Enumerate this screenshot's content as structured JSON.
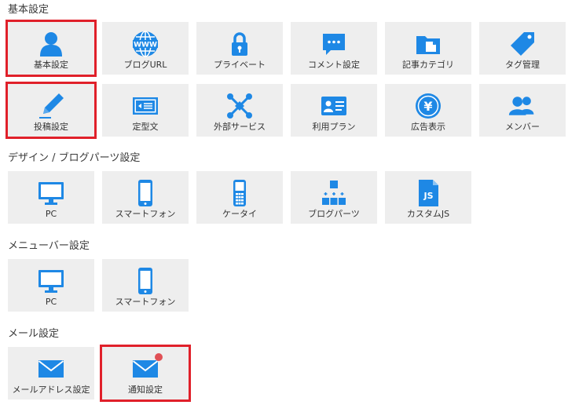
{
  "accent": "#1e88e5",
  "highlight_color": "#e0202a",
  "sections": [
    {
      "title": "基本設定",
      "tiles": [
        {
          "label": "基本設定",
          "icon": "user-icon",
          "highlighted": true
        },
        {
          "label": "ブログURL",
          "icon": "www-globe-icon"
        },
        {
          "label": "プライベート",
          "icon": "lock-icon"
        },
        {
          "label": "コメント設定",
          "icon": "comment-bubble-icon"
        },
        {
          "label": "記事カテゴリ",
          "icon": "folder-icon"
        },
        {
          "label": "タグ管理",
          "icon": "tag-icon"
        },
        {
          "label": "投稿設定",
          "icon": "pencil-icon",
          "highlighted": true
        },
        {
          "label": "定型文",
          "icon": "template-card-icon"
        },
        {
          "label": "外部サービス",
          "icon": "connections-icon"
        },
        {
          "label": "利用プラン",
          "icon": "id-card-icon"
        },
        {
          "label": "広告表示",
          "icon": "yen-coin-icon"
        },
        {
          "label": "メンバー",
          "icon": "members-icon"
        }
      ]
    },
    {
      "title": "デザイン / ブログパーツ設定",
      "tiles": [
        {
          "label": "PC",
          "icon": "monitor-icon"
        },
        {
          "label": "スマートフォン",
          "icon": "smartphone-icon"
        },
        {
          "label": "ケータイ",
          "icon": "feature-phone-icon"
        },
        {
          "label": "ブログパーツ",
          "icon": "blog-parts-icon"
        },
        {
          "label": "カスタムJS",
          "icon": "js-file-icon"
        }
      ]
    },
    {
      "title": "メニューバー設定",
      "tiles": [
        {
          "label": "PC",
          "icon": "monitor-icon"
        },
        {
          "label": "スマートフォン",
          "icon": "smartphone-icon"
        }
      ]
    },
    {
      "title": "メール設定",
      "tiles": [
        {
          "label": "メールアドレス設定",
          "icon": "mail-icon"
        },
        {
          "label": "通知設定",
          "icon": "mail-icon",
          "highlighted": true,
          "badge": true
        }
      ]
    }
  ]
}
